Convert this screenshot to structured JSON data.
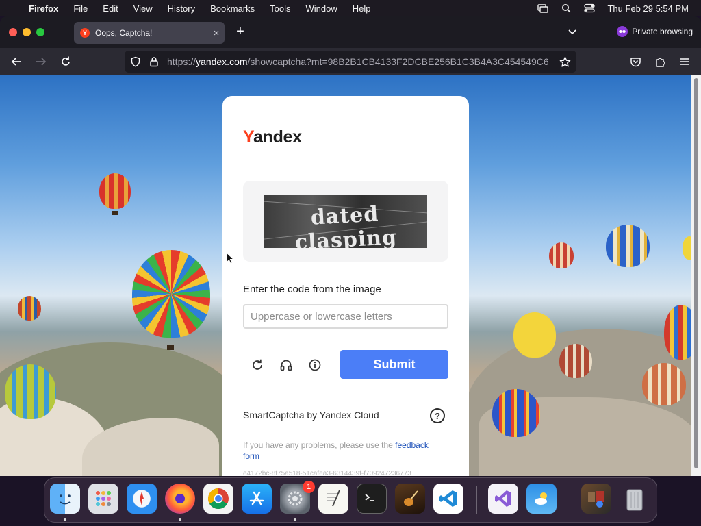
{
  "menubar": {
    "apple_icon": "apple-logo",
    "app_name": "Firefox",
    "items": [
      "File",
      "Edit",
      "View",
      "History",
      "Bookmarks",
      "Tools",
      "Window",
      "Help"
    ],
    "clock": "Thu Feb 29  5:54 PM"
  },
  "browser": {
    "tab_title": "Oops, Captcha!",
    "tab_favicon_letter": "Y",
    "new_tab_label": "+",
    "private_label": "Private browsing",
    "url_prefix": "https://",
    "url_host": "yandex.com",
    "url_path": "/showcaptcha?mt=98B2B1CB4133F2DCBE256B1C3B4A3C454549C6"
  },
  "captcha": {
    "logo_first": "Y",
    "logo_rest": "andex",
    "captcha_text": "dated clasping",
    "prompt": "Enter the code from the image",
    "input_placeholder": "Uppercase or lowercase letters",
    "input_value": "",
    "submit_label": "Submit",
    "provider": "SmartCaptcha by Yandex Cloud",
    "help_label": "?",
    "problems_text": "If you have any problems, please use the ",
    "feedback_link": "feedback form",
    "token": "e4172bc-8f75a518-51cafea3-6314439f-f709247236773"
  },
  "dock": {
    "badge_count": "1",
    "apps": [
      "finder-icon",
      "launchpad-icon",
      "safari-icon",
      "firefox-icon",
      "chrome-icon",
      "app-store-icon",
      "system-settings-icon",
      "textedit-icon",
      "terminal-icon",
      "garageband-icon",
      "vscode-icon",
      "visual-studio-icon",
      "weather-icon",
      "downloads-stack-icon",
      "trash-icon"
    ]
  },
  "colors": {
    "yandex_red": "#fc3f1d",
    "submit_blue": "#4b7ef7",
    "link_blue": "#1a4fb8"
  }
}
